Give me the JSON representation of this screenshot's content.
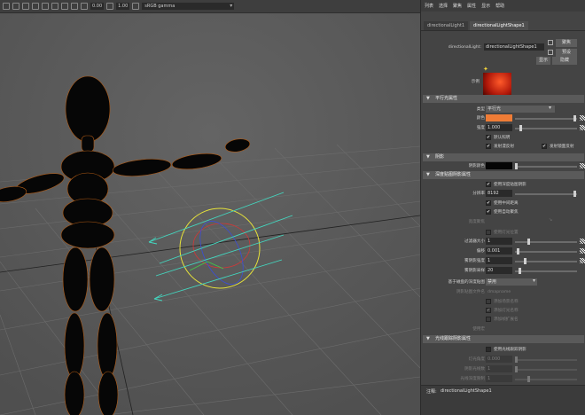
{
  "toolbar": {
    "field1": "0.00",
    "field2": "1.00",
    "colorspace": "sRGB gamma"
  },
  "menu": [
    "列表",
    "选择",
    "聚焦",
    "属性",
    "显示",
    "帮助"
  ],
  "tabs": [
    "directionalLight1",
    "directionalLightShape1"
  ],
  "node": {
    "type_label": "directionalLight:",
    "name": "directionalLightShape1",
    "focus_btn": "聚焦",
    "preset_btn": "预设",
    "show_btn": "显示",
    "hide_btn": "隐藏",
    "sample_label": "示例"
  },
  "sections": {
    "light_attrs": "平行光属性",
    "shadows": "阴影",
    "depth_map": "深度贴图阴影属性",
    "raytrace": "光线跟踪阴影属性"
  },
  "light": {
    "type_label": "类型",
    "type_value": "平行光",
    "color_label": "颜色",
    "intensity_label": "强度",
    "intensity_value": "1.000",
    "illum_default": "默认照明",
    "emit_diffuse": "发射漫反射",
    "emit_specular": "发射镜面反射"
  },
  "shadow": {
    "color_label": "阴影颜色"
  },
  "depth": {
    "use_depth": "使用深度贴图阴影",
    "resolution_label": "分辨率",
    "resolution_value": "8192",
    "mid_dist": "使用中间距离",
    "dropoff": "使用自动聚焦",
    "focus_label": "宽度聚焦",
    "light_space": "使用灯光位置",
    "filter_label": "过滤器大小",
    "filter_value": "1",
    "bias_label": "偏移",
    "bias_value": "0.001",
    "fog_label": "雾阴影强度",
    "fog_value": "1",
    "fog_samples_label": "雾阴影采样",
    "fog_samples_value": "20",
    "disk_label": "基于磁盘的深度贴图",
    "disk_value": "禁用",
    "map_name_label": "阴影贴图文件名",
    "map_name_value": "dmapname",
    "opt_scene": "添加场景名称",
    "opt_light": "添加灯光名称",
    "opt_frame": "添加帧扩展名",
    "use_macro": "使用宏"
  },
  "raytrace": {
    "use_ray": "使用光线跟踪阴影",
    "angle_label": "灯光角度",
    "angle_value": "0.000",
    "rays_label": "阴影光线数",
    "rays_value": "1",
    "depth_label": "光线深度限制",
    "depth_value": "1"
  },
  "footer": {
    "label": "注释:",
    "value": "directionalLightShape1"
  },
  "colors": {
    "light_color": "#ef7c36",
    "shadow_color": "#050505",
    "viewport_bg": "#5b5b5b",
    "panel_bg": "#444444"
  }
}
